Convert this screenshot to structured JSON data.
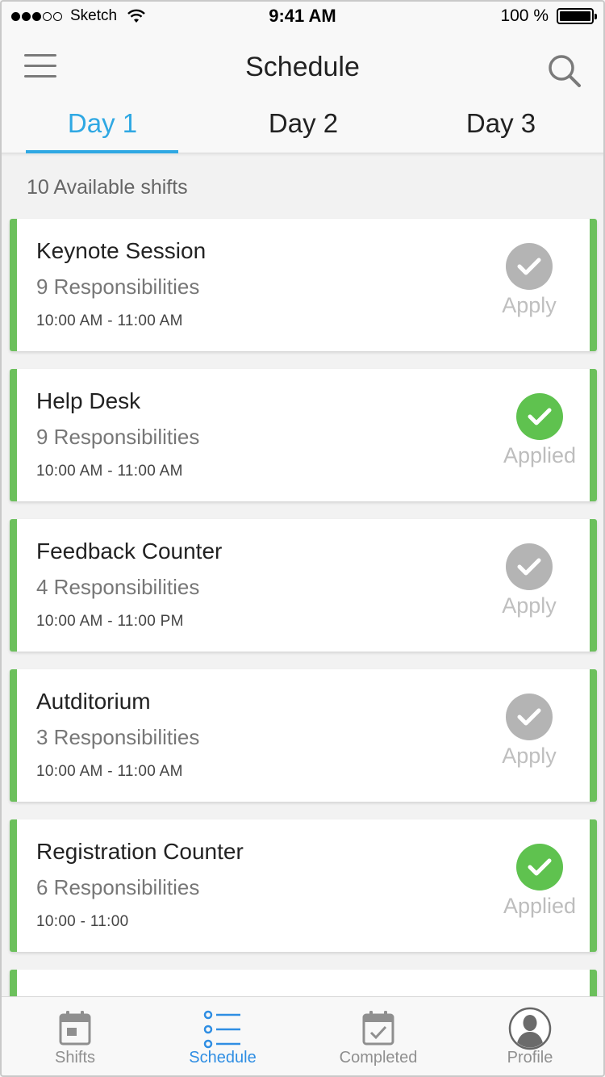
{
  "status_bar": {
    "carrier": "Sketch",
    "time": "9:41 AM",
    "battery": "100 %",
    "battery_level": 1.0,
    "signal_dots_filled": 3,
    "signal_dots_total": 5
  },
  "header": {
    "title": "Schedule",
    "menu_icon": "hamburger-menu-icon",
    "search_icon": "search-icon",
    "tabs": [
      {
        "label": "Day 1",
        "active": true
      },
      {
        "label": "Day 2",
        "active": false
      },
      {
        "label": "Day 3",
        "active": false
      }
    ]
  },
  "shifts": {
    "count_label": "10 Available shifts",
    "items": [
      {
        "title": "Keynote Session",
        "responsibilities": "9 Responsibilities",
        "time": "10:00  AM - 11:00 AM",
        "status": "Apply"
      },
      {
        "title": "Help Desk",
        "responsibilities": "9 Responsibilities",
        "time": "10:00  AM - 11:00 AM",
        "status": "Applied"
      },
      {
        "title": "Feedback Counter",
        "responsibilities": "4 Responsibilities",
        "time": "10:00  AM - 11:00 PM",
        "status": "Apply"
      },
      {
        "title": "Autditorium",
        "responsibilities": "3 Responsibilities",
        "time": "10:00  AM - 11:00 AM",
        "status": "Apply"
      },
      {
        "title": "Registration Counter",
        "responsibilities": "6 Responsibilities",
        "time": "10:00 - 11:00",
        "status": "Applied"
      }
    ]
  },
  "colors": {
    "accent_blue": "#2fa8e3",
    "green": "#6cc05c",
    "applied_green": "#5fc24f",
    "apply_grey": "#b4b4b4"
  },
  "tab_bar": {
    "items": [
      {
        "label": "Shifts",
        "icon": "calendar-icon",
        "active": false
      },
      {
        "label": "Schedule",
        "icon": "list-icon",
        "active": true
      },
      {
        "label": "Completed",
        "icon": "calendar-check-icon",
        "active": false
      },
      {
        "label": "Profile",
        "icon": "profile-avatar-icon",
        "active": false
      }
    ]
  }
}
